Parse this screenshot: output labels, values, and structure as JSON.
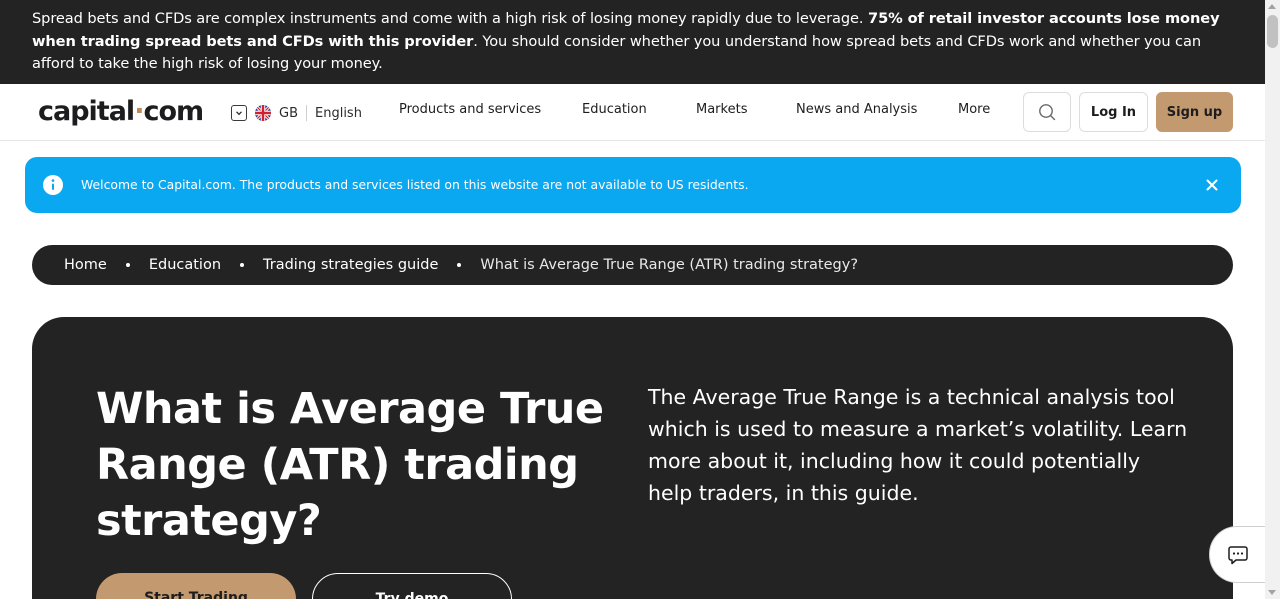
{
  "risk_warning": {
    "part1": "Spread bets and CFDs are complex instruments and come with a high risk of losing money rapidly due to leverage. ",
    "bold": "75% of retail investor accounts lose money when trading spread bets and CFDs with this provider",
    "part2": ". You should consider whether you understand how spread bets and CFDs work and whether you can afford to take the high risk of losing your money."
  },
  "header": {
    "logo_left": "capital",
    "logo_dot": "·",
    "logo_right": "com",
    "region_code": "GB",
    "language": "English",
    "nav": [
      "Products and services",
      "Education",
      "Markets",
      "News and Analysis",
      "More"
    ],
    "login_label": "Log In",
    "signup_label": "Sign up"
  },
  "notice": {
    "message": "Welcome to Capital.com. The products and services listed on this website are not available to US residents."
  },
  "breadcrumb": {
    "items": [
      "Home",
      "Education",
      "Trading strategies guide"
    ],
    "current": "What is Average True Range (ATR) trading strategy?"
  },
  "hero": {
    "title": "What is Average True Range (ATR) trading strategy?",
    "lead": "The Average True Range is a technical analysis tool which is used to measure a market’s volatility. Learn more about it, including how it could potentially help traders, in this guide.",
    "start_label": "Start Trading",
    "demo_label": "Try demo"
  },
  "colors": {
    "dark": "#232323",
    "accent": "#c39a6f",
    "notice_blue": "#0aa8f0"
  },
  "icons": [
    "search-icon",
    "info-icon",
    "close-icon",
    "chat-icon",
    "chevron-down-icon",
    "uk-flag-icon"
  ]
}
